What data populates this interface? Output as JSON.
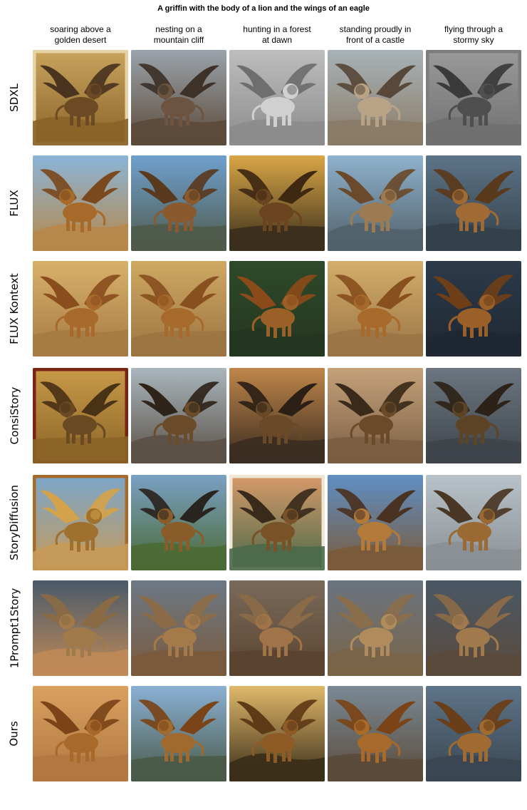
{
  "title": "A griffin with the body of a lion and the wings of an eagle",
  "columns": [
    "soaring above a\ngolden desert",
    "nesting on a\nmountain cliff",
    "hunting in a forest\nat dawn",
    "standing proudly in\nfront of a castle",
    "flying through a\nstormy sky"
  ],
  "rows": [
    "SDXL",
    "FLUX",
    "FLUX Kontext",
    "ConsiStory",
    "StoryDiffusion",
    "1Prompt1Story",
    "Ours"
  ],
  "palettes": {
    "SDXL": [
      {
        "sky": "#c9a45e",
        "ground": "#8a6328",
        "body": "#6b4a24",
        "wing": "#4a3420",
        "frame": "#e6d2a4"
      },
      {
        "sky": "#9aa3ab",
        "ground": "#5c4a3a",
        "body": "#6c5440",
        "wing": "#3d3128"
      },
      {
        "sky": "#bdbdbd",
        "ground": "#8c8c8c",
        "body": "#d0d0d0",
        "wing": "#6e6e6e"
      },
      {
        "sky": "#a8b2b8",
        "ground": "#8a7b66",
        "body": "#b9a386",
        "wing": "#57483a"
      },
      {
        "sky": "#9a9a9a",
        "ground": "#6f6f6f",
        "body": "#4f4f4f",
        "wing": "#3a3a3a",
        "frame": "#7d7d7d"
      }
    ],
    "FLUX": [
      {
        "sky": "#8ab4d8",
        "ground": "#b78748",
        "body": "#a86a2a",
        "wing": "#7a4a1e"
      },
      {
        "sky": "#6fa0cf",
        "ground": "#4f5a4a",
        "body": "#8a5a2e",
        "wing": "#5a3a1e"
      },
      {
        "sky": "#d9a646",
        "ground": "#3a2e1c",
        "body": "#6b4420",
        "wing": "#3e2812"
      },
      {
        "sky": "#8fb2cd",
        "ground": "#51606a",
        "body": "#9c7a52",
        "wing": "#6a4a2a"
      },
      {
        "sky": "#5d7488",
        "ground": "#33404a",
        "body": "#a06a34",
        "wing": "#5a3a1c"
      }
    ],
    "FLUX Kontext": [
      {
        "sky": "#d9b06a",
        "ground": "#a67a44",
        "body": "#a86a2a",
        "wing": "#8a4e1e"
      },
      {
        "sky": "#cfa862",
        "ground": "#9c7442",
        "body": "#a66a2c",
        "wing": "#88501f"
      },
      {
        "sky": "#2e4a2a",
        "ground": "#24361f",
        "body": "#9a6028",
        "wing": "#8a4a1a"
      },
      {
        "sky": "#d4ad6a",
        "ground": "#9a7446",
        "body": "#a86a2a",
        "wing": "#88501f"
      },
      {
        "sky": "#2c3a4a",
        "ground": "#1f2832",
        "body": "#9a6028",
        "wing": "#6e3e18"
      }
    ],
    "ConsiStory": [
      {
        "sky": "#c89a48",
        "ground": "#8c6428",
        "body": "#6a4a22",
        "wing": "#4a3216",
        "frame": "#7a2418"
      },
      {
        "sky": "#a9b6bd",
        "ground": "#5b5046",
        "body": "#6a4c2a",
        "wing": "#2e241a"
      },
      {
        "sky": "#c0864a",
        "ground": "#3a2c20",
        "body": "#6a4a26",
        "wing": "#2c2016"
      },
      {
        "sky": "#c4a27a",
        "ground": "#7a5e44",
        "body": "#6a4a28",
        "wing": "#3a2a1a"
      },
      {
        "sky": "#6c7680",
        "ground": "#3e444a",
        "body": "#5e4426",
        "wing": "#2c2218"
      }
    ],
    "StoryDiffusion": [
      {
        "sky": "#7aa6cc",
        "ground": "#c79a58",
        "body": "#a0702e",
        "wing": "#d4a24a",
        "frame": "#a86a2a"
      },
      {
        "sky": "#7aa0c4",
        "ground": "#4a6a34",
        "body": "#8a5c2a",
        "wing": "#2a2420"
      },
      {
        "sky": "#d89a6a",
        "ground": "#4a6a4a",
        "body": "#7a5228",
        "wing": "#3a2a1c",
        "frame": "#efe6d4"
      },
      {
        "sky": "#5f8fc4",
        "ground": "#7a5a3a",
        "body": "#b47a3a",
        "wing": "#4a3222"
      },
      {
        "sky": "#b8c2c8",
        "ground": "#8a8f94",
        "body": "#9a6a32",
        "wing": "#4a3624"
      }
    ],
    "1Prompt1Story": [
      {
        "sky": "#4a5a6a",
        "ground": "#c08a58",
        "body": "#a07a4a",
        "wing": "#8a6a44"
      },
      {
        "sky": "#6c7886",
        "ground": "#7a5a3c",
        "body": "#a47a4a",
        "wing": "#8c6c48"
      },
      {
        "sky": "#7a6a5a",
        "ground": "#5a4430",
        "body": "#a07448",
        "wing": "#8a6a48"
      },
      {
        "sky": "#6a7480",
        "ground": "#7a6448",
        "body": "#b08c5c",
        "wing": "#8a6e4c"
      },
      {
        "sky": "#4a5866",
        "ground": "#5a4a3c",
        "body": "#a07a4c",
        "wing": "#8a6a48"
      }
    ],
    "Ours": [
      {
        "sky": "#d9a060",
        "ground": "#b07840",
        "body": "#a86a2a",
        "wing": "#7a4418"
      },
      {
        "sky": "#8ab0d4",
        "ground": "#4a5a48",
        "body": "#a06a2e",
        "wing": "#7a4418"
      },
      {
        "sky": "#e0b86a",
        "ground": "#3a2e1a",
        "body": "#8e5a26",
        "wing": "#5e3a16"
      },
      {
        "sky": "#7a8a96",
        "ground": "#5a4a3a",
        "body": "#a86a2a",
        "wing": "#7a4418"
      },
      {
        "sky": "#5e7488",
        "ground": "#3a4652",
        "body": "#a06a30",
        "wing": "#6a3e18"
      }
    ]
  }
}
